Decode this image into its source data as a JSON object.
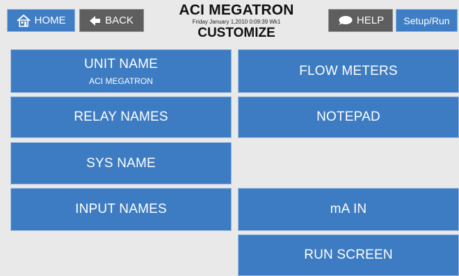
{
  "header": {
    "home_label": "HOME",
    "back_label": "BACK",
    "help_label": "HELP",
    "setup_label": "Setup/Run",
    "unit_title": "ACI MEGATRON",
    "datetime": "Friday January 1,2010 0:09:39 Wk1",
    "screen_title": "CUSTOMIZE"
  },
  "buttons": {
    "unit_name": {
      "label": "UNIT NAME",
      "value": "ACI MEGATRON"
    },
    "flow_meters": "FLOW METERS",
    "relay_names": "RELAY NAMES",
    "notepad": "NOTEPAD",
    "sys_name": "SYS NAME",
    "input_names": "INPUT NAMES",
    "ma_in": "mA IN",
    "run_screen": "RUN SCREEN"
  },
  "icons": {
    "home": "home-icon",
    "back": "back-arrow-icon",
    "help": "speech-bubble-icon"
  },
  "colors": {
    "button_blue": "#3d7cc2",
    "button_dark": "#5e5e5e",
    "background": "#e9e9e9"
  }
}
